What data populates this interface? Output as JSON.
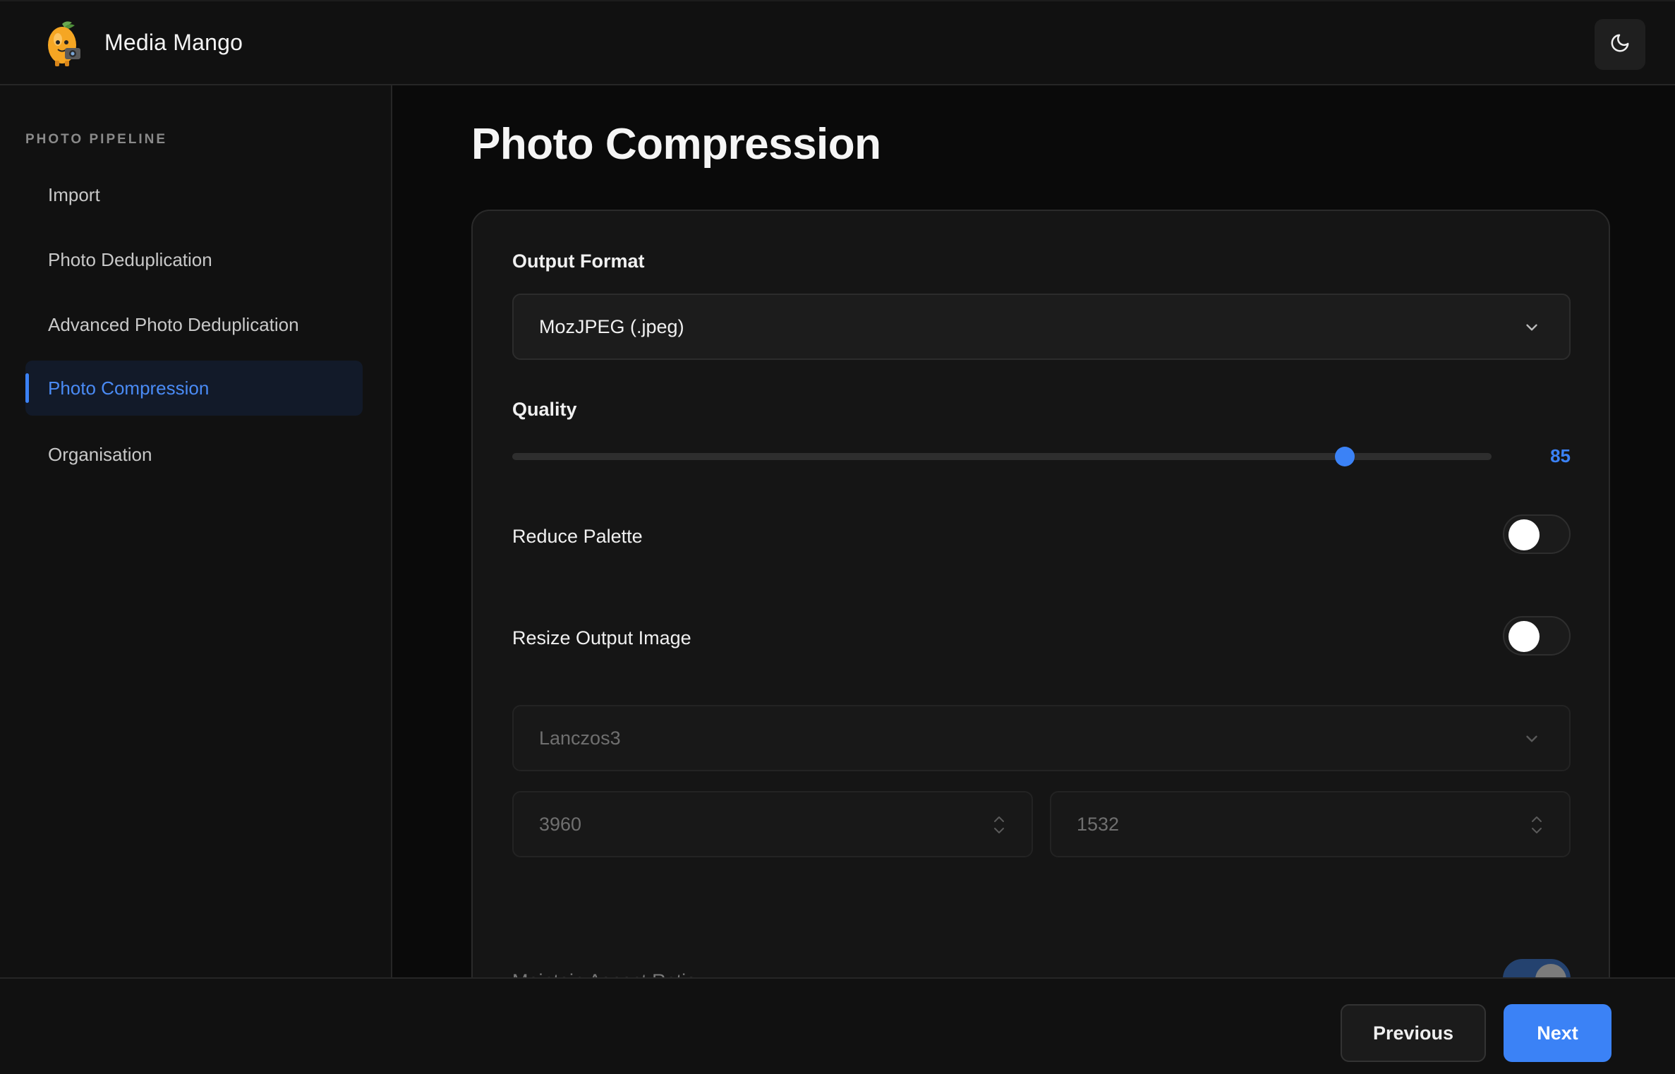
{
  "header": {
    "app_title": "Media Mango",
    "logo_icon": "mango-mascot-icon",
    "theme_icon": "moon-icon"
  },
  "sidebar": {
    "section_label": "PHOTO PIPELINE",
    "items": [
      {
        "label": "Import",
        "active": false
      },
      {
        "label": "Photo Deduplication",
        "active": false
      },
      {
        "label": "Advanced Photo Deduplication",
        "active": false
      },
      {
        "label": "Photo Compression",
        "active": true
      },
      {
        "label": "Organisation",
        "active": false
      }
    ]
  },
  "main": {
    "page_title": "Photo Compression",
    "output_format": {
      "label": "Output Format",
      "selected": "MozJPEG (.jpeg)"
    },
    "quality": {
      "label": "Quality",
      "value": "85",
      "min": 0,
      "max": 100
    },
    "reduce_palette": {
      "label": "Reduce Palette",
      "on": false
    },
    "resize_output": {
      "label": "Resize Output Image",
      "on": false
    },
    "resize_method": {
      "selected": "Lanczos3",
      "disabled": true
    },
    "width_value": "3960",
    "height_value": "1532",
    "maintain_aspect": {
      "label": "Maintain Aspect Ratio",
      "on": true,
      "disabled": true
    }
  },
  "footer": {
    "previous_label": "Previous",
    "next_label": "Next"
  },
  "colors": {
    "accent": "#3b82f6",
    "background": "#0a0a0a",
    "panel": "#111111"
  }
}
